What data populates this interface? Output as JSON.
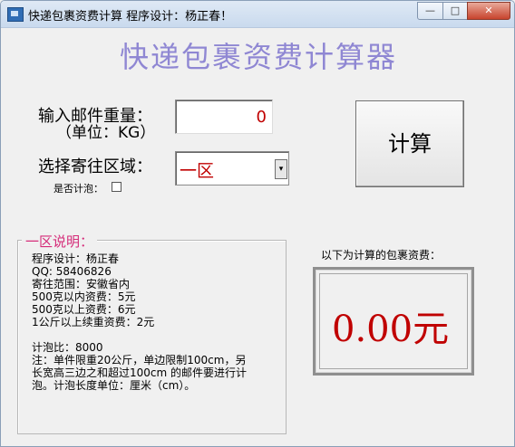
{
  "window": {
    "title": "快递包裹资费计算  程序设计：杨正春！",
    "controls": {
      "minimize": "—",
      "maximize": "□",
      "close": "✕"
    }
  },
  "heading": "快递包裹资费计算器",
  "weight": {
    "label_line1": "输入邮件重量：",
    "label_line2": "（单位：KG）",
    "value": "0"
  },
  "region": {
    "label": "选择寄往区域：",
    "selected": "一区",
    "arrow": "▾"
  },
  "bubble": {
    "label": "是否计泡：",
    "checked": false
  },
  "calculate_label": "计算",
  "info": {
    "title": "一区说明：",
    "lines": [
      "程序设计：杨正春",
      "QQ: 58406826",
      "寄往范围：安徽省内",
      "500克以内资费：5元",
      "500克以上资费：6元",
      "1公斤以上续重资费：2元",
      "",
      "计泡比：8000",
      "注：单件限重20公斤，单边限制100cm，另",
      "长宽高三边之和超过100cm 的邮件要进行计",
      "泡。计泡长度单位：厘米（cm）。"
    ]
  },
  "result": {
    "label": "以下为计算的包裹资费：",
    "value": "0.00元"
  },
  "colors": {
    "heading": "#8f87d3",
    "value_red": "#c00000",
    "group_title": "#d52b79"
  },
  "icons": {
    "app": "package-app-icon",
    "dropdown": "chevron-down-icon"
  }
}
